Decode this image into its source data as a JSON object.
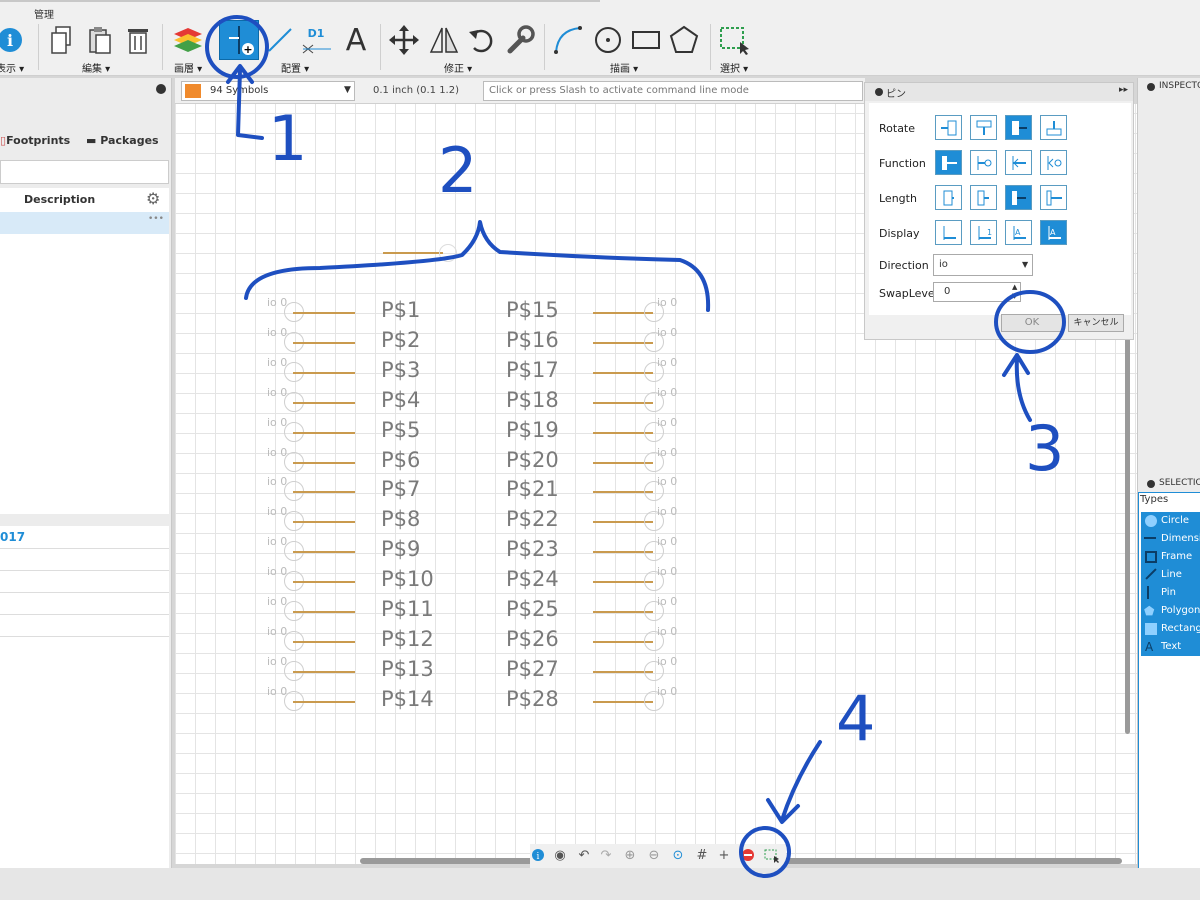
{
  "toolbar": {
    "title": "管理",
    "groups": {
      "display": "表示 ▾",
      "edit": "編集 ▾",
      "layer": "画層 ▾",
      "place": "配置 ▾",
      "modify": "修正 ▾",
      "draw": "描画 ▾",
      "select": "選択 ▾"
    },
    "d1_label": "D1",
    "text_tool_label": "A"
  },
  "command_bar": {
    "symbol_dropdown": "94 Symbols",
    "grid": "0.1 inch (0.1 1.2)",
    "command_placeholder": "Click or press Slash to activate command line mode",
    "swatch_color": "#f08a2c"
  },
  "left_panel": {
    "tabs": [
      "Footprints",
      "Packages"
    ],
    "column_description": "Description",
    "ellipsis": "•••",
    "year_fragment": "017"
  },
  "pins_left": [
    "P$1",
    "P$2",
    "P$3",
    "P$4",
    "P$5",
    "P$6",
    "P$7",
    "P$8",
    "P$9",
    "P$10",
    "P$11",
    "P$12",
    "P$13",
    "P$14"
  ],
  "pins_right": [
    "P$15",
    "P$16",
    "P$17",
    "P$18",
    "P$19",
    "P$20",
    "P$21",
    "P$22",
    "P$23",
    "P$24",
    "P$25",
    "P$26",
    "P$27",
    "P$28"
  ],
  "pin_io_text": "io 0",
  "pin_dialog": {
    "title": "ピン",
    "rows": [
      "Rotate",
      "Function",
      "Length",
      "Display"
    ],
    "direction_label": "Direction",
    "direction_value": "io",
    "swaplevel_label": "SwapLevel",
    "swaplevel_value": "0",
    "ok": "OK",
    "cancel": "キャンセル",
    "accent": "#1f8dd6"
  },
  "right_panel": {
    "inspector": "INSPECTOR",
    "selection": "SELECTION",
    "types_label": "Types",
    "types": [
      "Circle",
      "Dimension",
      "Frame",
      "Line",
      "Pin",
      "Polygon",
      "Rectangle",
      "Text"
    ]
  },
  "annotations": [
    "1",
    "2",
    "3",
    "4"
  ],
  "colors": {
    "annotation": "#1e4fc0",
    "pin_line": "#c99a4e",
    "selected": "#1f8dd6"
  }
}
